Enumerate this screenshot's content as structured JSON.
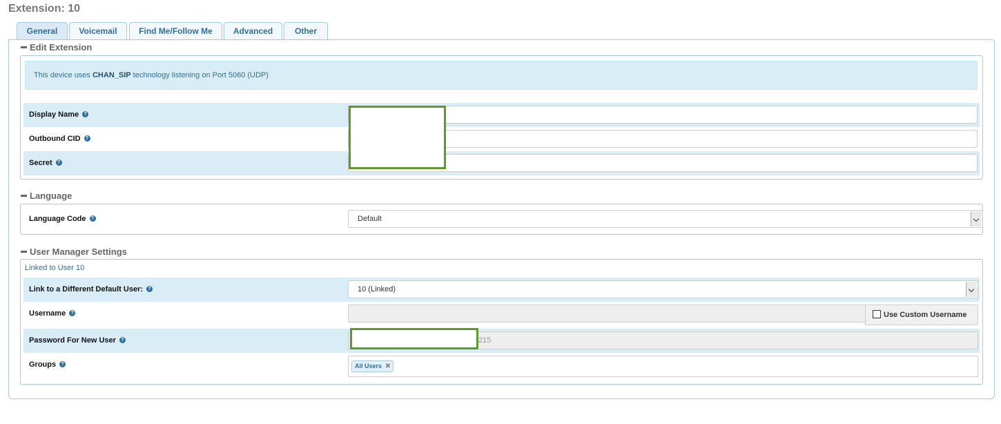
{
  "page": {
    "title": "Extension: 10"
  },
  "tabs": [
    "General",
    "Voicemail",
    "Find Me/Follow Me",
    "Advanced",
    "Other"
  ],
  "sections": {
    "edit_extension": {
      "title": "Edit Extension",
      "alert": {
        "prefix": "This device uses ",
        "tech": "CHAN_SIP",
        "suffix": " technology listening on Port 5060 (UDP)"
      },
      "display_name_label": "Display Name",
      "outbound_cid_label": "Outbound CID",
      "secret_label": "Secret",
      "display_name_value": "",
      "outbound_cid_value": "",
      "secret_value": ""
    },
    "language": {
      "title": "Language",
      "code_label": "Language Code",
      "code_value": "Default"
    },
    "user_manager": {
      "title": "User Manager Settings",
      "linked_text": "Linked to User 10",
      "link_label": "Link to a Different Default User:",
      "link_value": "10 (Linked)",
      "username_label": "Username",
      "username_value": "",
      "custom_username_label": "Use Custom Username",
      "password_label": "Password For New User",
      "password_visible": "215",
      "groups_label": "Groups",
      "group_chip": "All Users"
    }
  },
  "icons": {
    "help": "help-icon",
    "collapse": "collapse-icon",
    "remove": "remove-icon",
    "select": "chevron-down-icon"
  },
  "colors": {
    "accent": "#2e6e9e",
    "alert_bg": "#d9edf7",
    "redaction_border": "#5c9a2e"
  }
}
